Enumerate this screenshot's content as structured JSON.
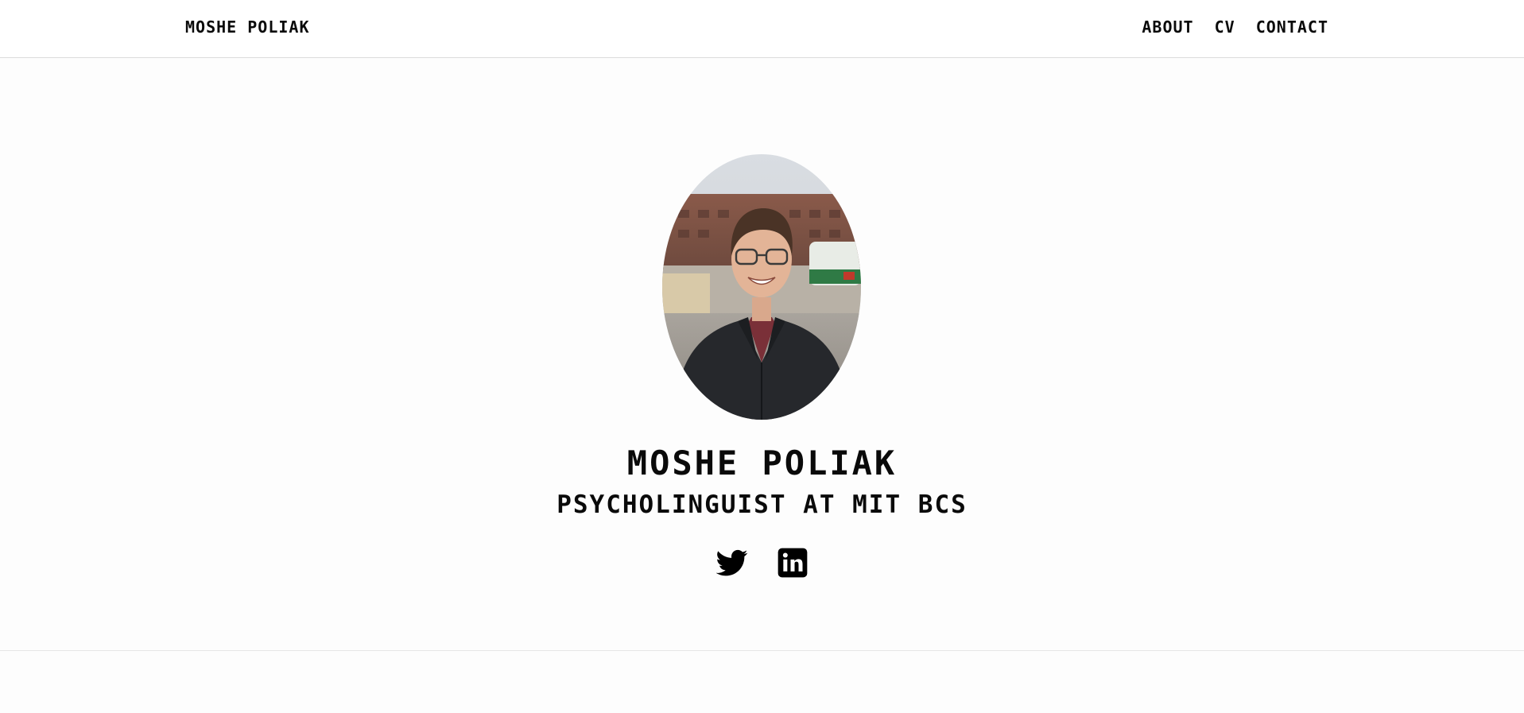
{
  "header": {
    "brand": "MOSHE POLIAK",
    "nav": [
      {
        "label": "ABOUT"
      },
      {
        "label": "CV"
      },
      {
        "label": "CONTACT"
      }
    ]
  },
  "profile": {
    "name": "MOSHE POLIAK",
    "title": "PSYCHOLINGUIST AT MIT BCS",
    "photo_alt": "Portrait of Moshe Poliak"
  },
  "socials": [
    {
      "icon": "twitter-icon"
    },
    {
      "icon": "linkedin-icon"
    }
  ]
}
